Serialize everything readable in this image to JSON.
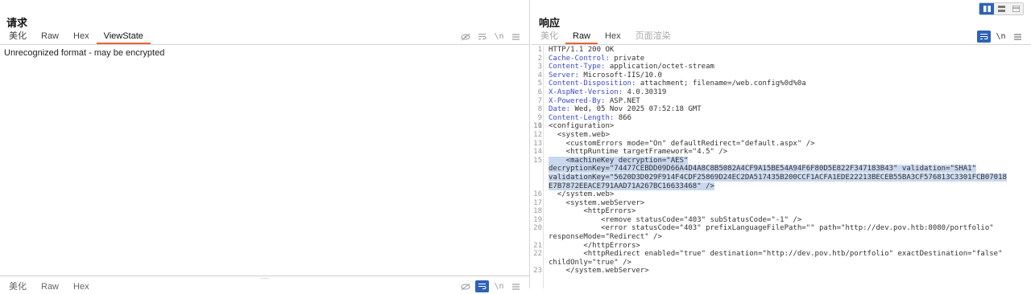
{
  "request": {
    "title": "请求",
    "tabs": [
      "美化",
      "Raw",
      "Hex",
      "ViewState"
    ],
    "active_tab": "ViewState",
    "tool_icons": [
      "eye-slash-icon",
      "wrap-lines-icon",
      "newline-icon",
      "menu-icon"
    ],
    "message": "Unrecognized format - may be encrypted",
    "bottom_tabs": [
      "美化",
      "Raw",
      "Hex"
    ],
    "bottom_icons": [
      "eye-slash-icon",
      "wrap-lines-icon",
      "newline-icon",
      "menu-icon"
    ]
  },
  "response": {
    "title": "响应",
    "tabs": [
      "美化",
      "Raw",
      "Hex",
      "页面渲染"
    ],
    "active_tab": "Raw",
    "tool_icons": [
      "wrap-lines-icon",
      "newline-icon",
      "menu-icon"
    ],
    "lines": [
      {
        "n": "1",
        "text": "HTTP/1.1 200 OK"
      },
      {
        "n": "2",
        "key": "Cache-Control:",
        "val": " private"
      },
      {
        "n": "3",
        "key": "Content-Type:",
        "val": " application/octet-stream"
      },
      {
        "n": "4",
        "key": "Server:",
        "val": " Microsoft-IIS/10.0"
      },
      {
        "n": "5",
        "key": "Content-Disposition:",
        "val": " attachment; filename=/web.config%0d%0a"
      },
      {
        "n": "6",
        "key": "X-AspNet-Version:",
        "val": " 4.0.30319"
      },
      {
        "n": "7",
        "key": "X-Powered-By:",
        "val": " ASP.NET"
      },
      {
        "n": "8",
        "key": "Date:",
        "val": " Wed, 05 Nov 2025 07:52:18 GMT"
      },
      {
        "n": "9",
        "key": "Content-Length:",
        "val": " 866"
      },
      {
        "n": "10",
        "text": ""
      },
      {
        "n": "11",
        "text": "<configuration>"
      },
      {
        "n": "12",
        "text": "  <system.web>"
      },
      {
        "n": "13",
        "text": "    <customErrors mode=\"On\" defaultRedirect=\"default.aspx\" />"
      },
      {
        "n": "14",
        "text": "    <httpRuntime targetFramework=\"4.5\" />"
      },
      {
        "n": "15",
        "text": "    <machineKey decryption=\"AES\"",
        "highlight": true,
        "cont": [
          "decryptionKey=\"74477CEBDD09D66A4D4A8C8B5082A4CF9A15BE54A94F6F80D5E822F347183B43\" validation=\"SHA1\"",
          "validationKey=\"5620D3D029F914F4CDF25869D24EC2DA517435B200CCF1ACFA1EDE22213BECEB55BA3CF576813C3301FCB07018",
          "E7B7872EEACE791AAD71A267BC16633468\" />"
        ]
      },
      {
        "n": "16",
        "text": "  </system.web>"
      },
      {
        "n": "17",
        "text": "    <system.webServer>"
      },
      {
        "n": "18",
        "text": "        <httpErrors>"
      },
      {
        "n": "19",
        "text": "            <remove statusCode=\"403\" subStatusCode=\"-1\" />"
      },
      {
        "n": "20",
        "text": "            <error statusCode=\"403\" prefixLanguageFilePath=\"\" path=\"http://dev.pov.htb:8080/portfolio\"",
        "cont": [
          "responseMode=\"Redirect\" />"
        ]
      },
      {
        "n": "21",
        "text": "        </httpErrors>"
      },
      {
        "n": "22",
        "text": "        <httpRedirect enabled=\"true\" destination=\"http://dev.pov.htb/portfolio\" exactDestination=\"false\"",
        "cont": [
          "childOnly=\"true\" />"
        ]
      },
      {
        "n": "23",
        "text": "    </system.webServer>"
      }
    ]
  },
  "layout_switch": [
    "split-columns-icon",
    "split-rows-icon",
    "tabs-icon"
  ]
}
